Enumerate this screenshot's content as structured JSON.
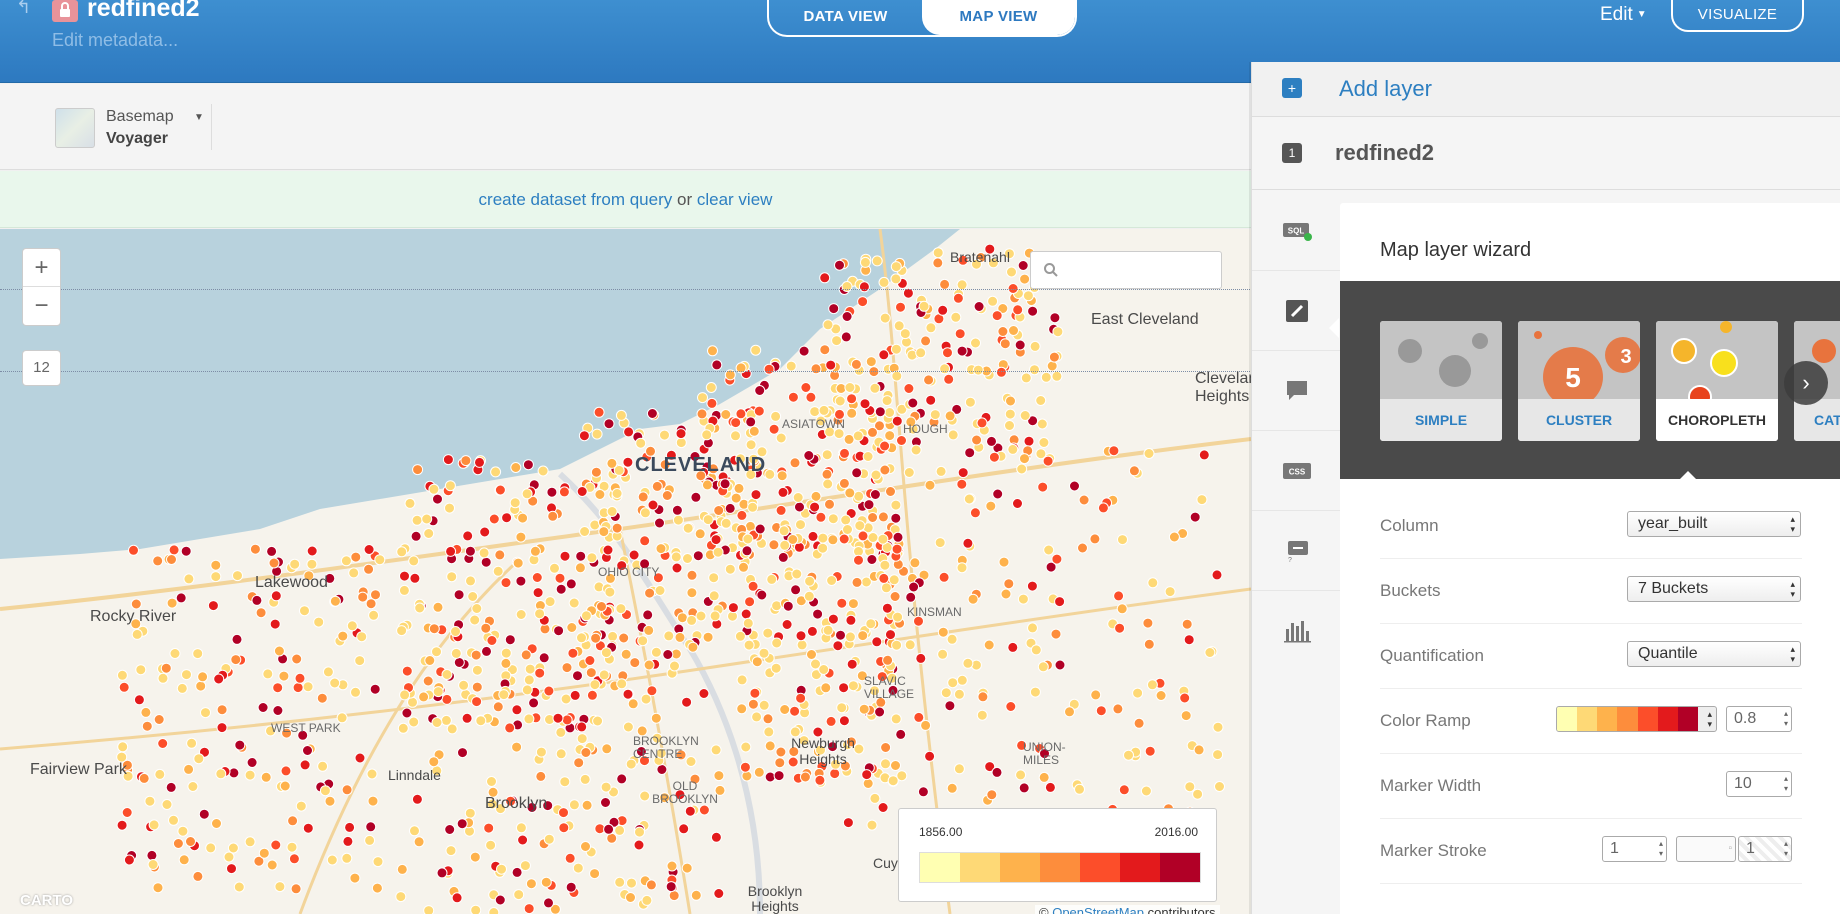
{
  "header": {
    "title": "redfined2",
    "edit_metadata": "Edit metadata...",
    "tabs": [
      {
        "label": "DATA VIEW",
        "active": false
      },
      {
        "label": "MAP VIEW",
        "active": true
      }
    ],
    "edit_menu": "Edit",
    "visualize": "VISUALIZE"
  },
  "toolbar": {
    "basemap_label": "Basemap",
    "basemap_value": "Voyager"
  },
  "query_bar": {
    "create_link": "create dataset from query",
    "or_text": "or",
    "clear_link": "clear view"
  },
  "map": {
    "zoom_in": "+",
    "zoom_out": "−",
    "zoom_level": "12",
    "places": [
      {
        "name": "Bratenahl"
      },
      {
        "name": "East Cleveland"
      },
      {
        "name": "Cleveland Heights"
      },
      {
        "name": "CLEVELAND"
      },
      {
        "name": "ASIATOWN"
      },
      {
        "name": "HOUGH"
      },
      {
        "name": "Lakewood"
      },
      {
        "name": "Rocky River"
      },
      {
        "name": "OHIO CITY"
      },
      {
        "name": "KINSMAN"
      },
      {
        "name": "WEST PARK"
      },
      {
        "name": "SLAVIC VILLAGE"
      },
      {
        "name": "BROOKLYN CENTRE"
      },
      {
        "name": "Newburgh Heights"
      },
      {
        "name": "UNION-MILES"
      },
      {
        "name": "Fairview Park"
      },
      {
        "name": "Linndale"
      },
      {
        "name": "OLD BROOKLYN"
      },
      {
        "name": "Brooklyn"
      },
      {
        "name": "Brooklyn Heights"
      },
      {
        "name": "Cuy"
      }
    ],
    "legend": {
      "min": "1856.00",
      "max": "2016.00",
      "colors": [
        "#ffffb2",
        "#fed976",
        "#feb24c",
        "#fd8d3c",
        "#fc4e2a",
        "#e31a1c",
        "#b10026"
      ]
    },
    "attribution_prefix": "©",
    "attribution_link": "OpenStreetMap",
    "attribution_suffix": "contributors",
    "carto_logo": "CARTO"
  },
  "panel": {
    "add_layer": "Add layer",
    "layer_number": "1",
    "layer_name": "redfined2",
    "tools": [
      "sql-icon",
      "wizard-icon",
      "infowindow-icon",
      "css-icon",
      "legend-icon",
      "filters-icon"
    ],
    "wizard_title": "Map layer wizard",
    "types": [
      {
        "label": "SIMPLE",
        "active": false
      },
      {
        "label": "CLUSTER",
        "active": false
      },
      {
        "label": "CHOROPLETH",
        "active": true
      },
      {
        "label": "CAT",
        "active": false
      }
    ],
    "cluster_numbers": [
      "5",
      "3"
    ],
    "fields": {
      "column_label": "Column",
      "column_value": "year_built",
      "buckets_label": "Buckets",
      "buckets_value": "7 Buckets",
      "quant_label": "Quantification",
      "quant_value": "Quantile",
      "ramp_label": "Color Ramp",
      "ramp_opacity": "0.8",
      "marker_width_label": "Marker Width",
      "marker_width_value": "10",
      "marker_stroke_label": "Marker Stroke",
      "marker_stroke_value": "1",
      "marker_stroke_opacity": "1"
    },
    "ramp_colors": [
      "#ffffb2",
      "#fed976",
      "#feb24c",
      "#fd8d3c",
      "#fc4e2a",
      "#e31a1c",
      "#b10026"
    ]
  }
}
